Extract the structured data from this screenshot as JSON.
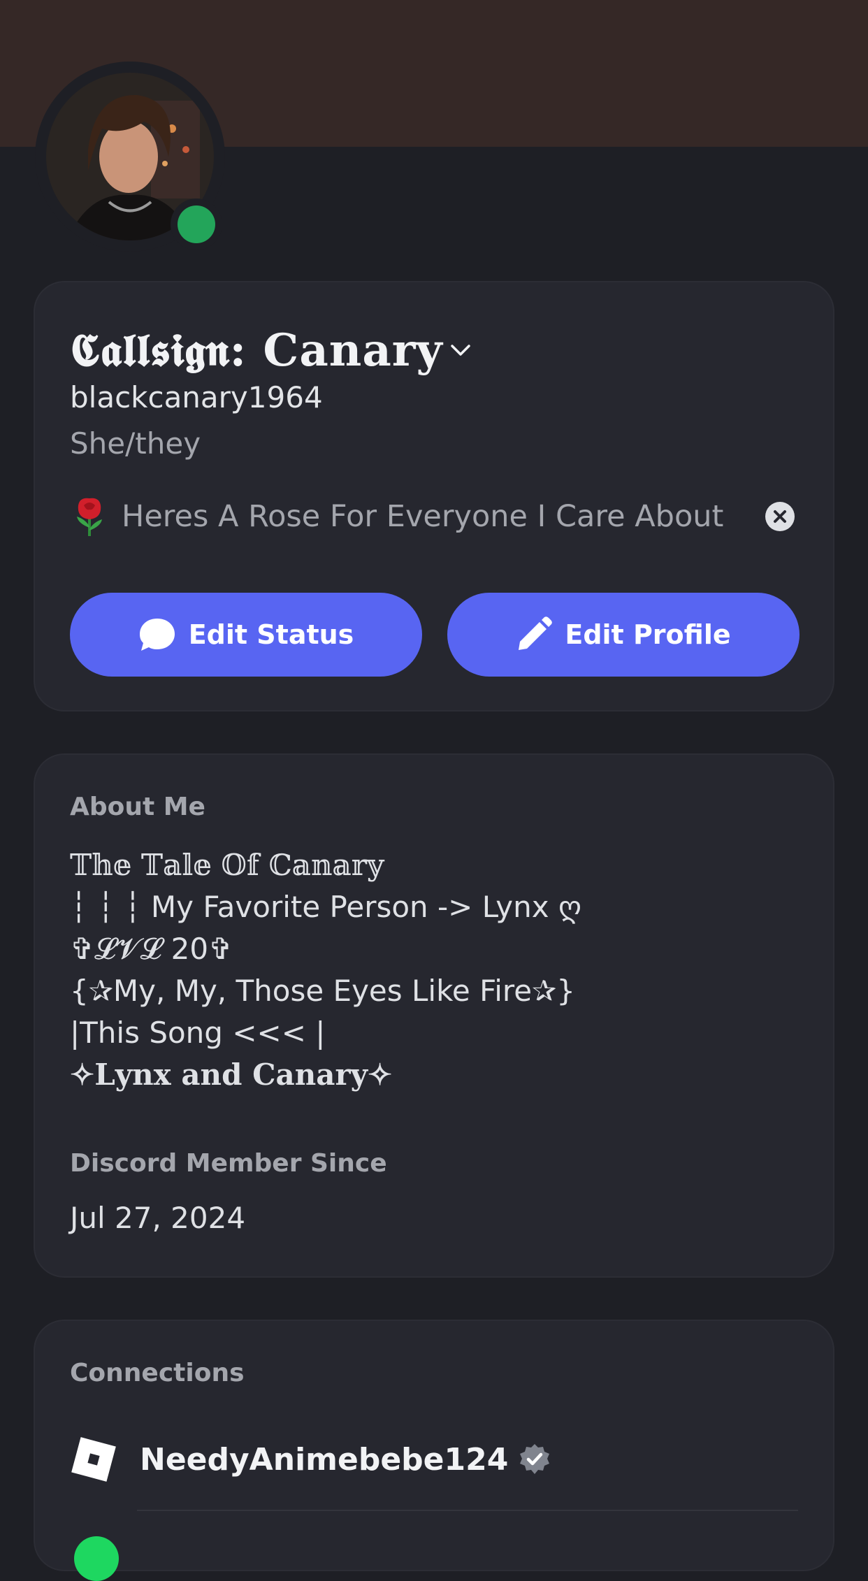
{
  "theme": {
    "background": "#1e1f25",
    "card": "#26272f",
    "banner": "#352826",
    "accent": "#5865f2",
    "online": "#23a55a",
    "muted_text": "#a4a6ad"
  },
  "profile": {
    "avatar_icon": "avatar-illustration",
    "status_indicator": "online",
    "display_name": "𝕮𝖆𝖑𝖑𝖘𝖎𝖌𝖓: Canary",
    "username": "blackcanary1964",
    "pronouns": "She/they",
    "custom_status": {
      "emoji": "rose-icon",
      "text": "Heres A Rose For Everyone I Care About"
    }
  },
  "actions": {
    "edit_status": "Edit Status",
    "edit_profile": "Edit Profile"
  },
  "about": {
    "title": "About Me",
    "lines": [
      "𝕋𝕙𝕖 𝕋𝕒𝕝𝕖 𝕆𝕗 ℂ𝕒𝕟𝕒𝕣𝕪",
      "┆ ┆ ┆ My Favorite Person -> Lynx ღ",
      "✞𝓛𝓥𝓛 20✞",
      "{✰My, My, Those Eyes Like Fire✰}",
      "|This Song <<< |",
      "✧𝐋𝐲𝐧𝐱 𝐚𝐧𝐝 𝐂𝐚𝐧𝐚𝐫𝐲✧"
    ]
  },
  "member_since": {
    "title": "Discord Member Since",
    "date": "Jul 27, 2024"
  },
  "connections": {
    "title": "Connections",
    "items": [
      {
        "service_icon": "roblox-icon",
        "name": "NeedyAnimebebe124",
        "verified": true
      }
    ]
  }
}
